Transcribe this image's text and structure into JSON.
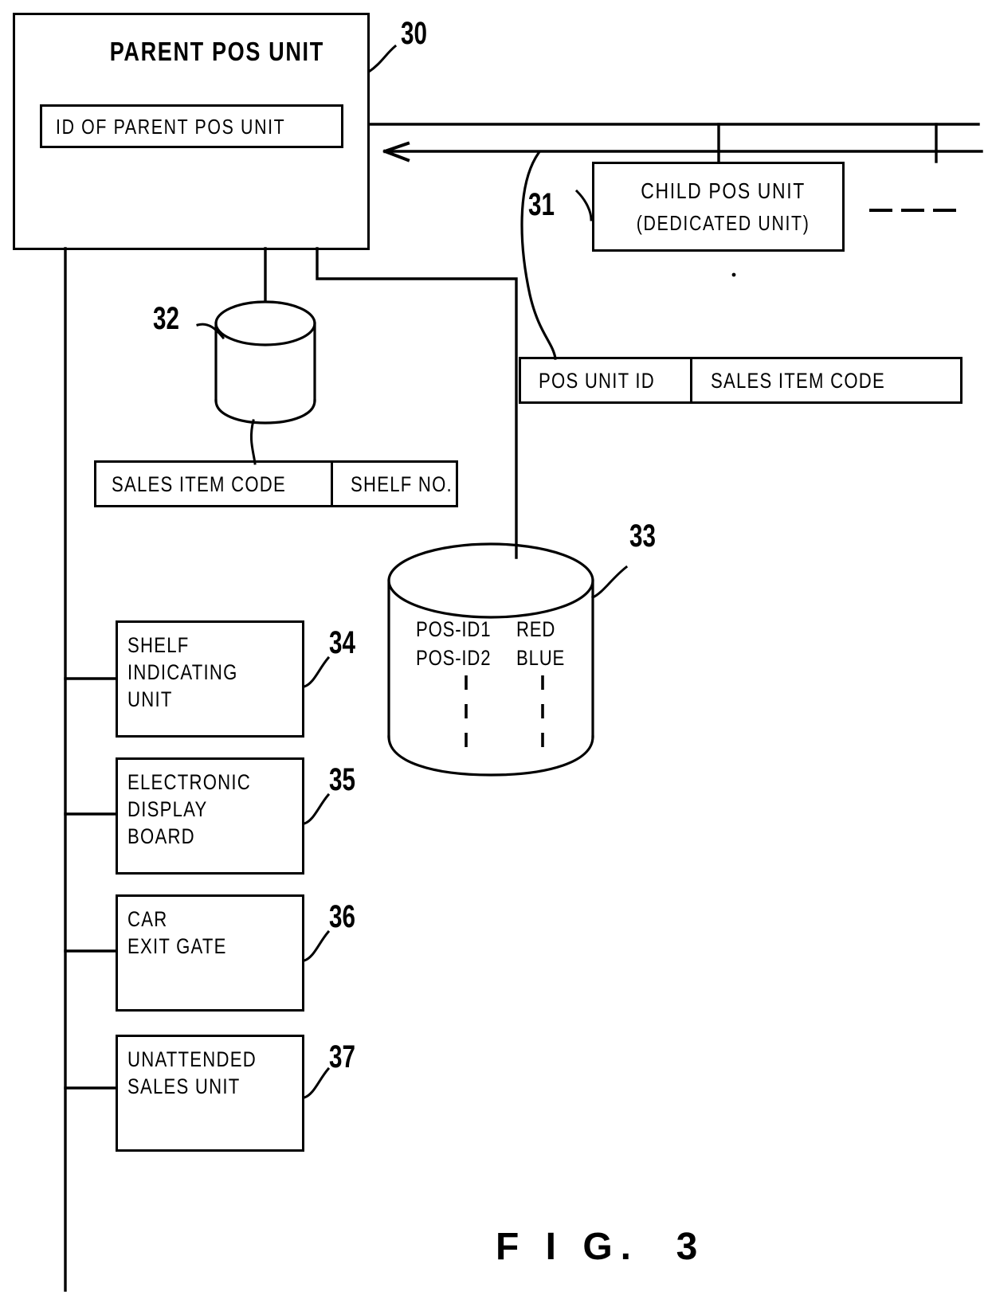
{
  "figure": {
    "caption": "F I G.  3",
    "background": "#ffffff",
    "ink": "#000000"
  },
  "blocks": {
    "parent_pos": {
      "title": "PARENT POS UNIT",
      "ref": "30",
      "inner_field": "ID OF PARENT POS UNIT"
    },
    "child_pos": {
      "title": "CHILD POS UNIT",
      "subtitle": "(DEDICATED UNIT)",
      "ref": "31"
    },
    "shelf_indicating_unit": {
      "label": "SHELF\nINDICATING\nUNIT",
      "ref": "34"
    },
    "electronic_display_board": {
      "label": "ELECTRONIC\nDISPLAY\nBOARD",
      "ref": "35"
    },
    "car_exit_gate": {
      "label": "CAR\nEXIT GATE",
      "ref": "36"
    },
    "unattended_sales_unit": {
      "label": "UNATTENDED\nSALES UNIT",
      "ref": "37"
    }
  },
  "tables": {
    "item_shelf_table": {
      "columns": [
        "SALES ITEM CODE",
        "SHELF NO."
      ]
    },
    "pos_sales_table": {
      "columns": [
        "POS UNIT ID",
        "SALES ITEM CODE"
      ]
    }
  },
  "databases": {
    "item_shelf_db": {
      "ref": "32",
      "contents": []
    },
    "pos_color_db": {
      "ref": "33",
      "rows": [
        {
          "id": "POS-ID1",
          "color": "RED"
        },
        {
          "id": "POS-ID2",
          "color": "BLUE"
        }
      ],
      "continuation": "vertical-dotted-ellipsis"
    }
  },
  "connections": {
    "bus_note": "network bus from parent POS unit to child POS units",
    "dashed_continuation": "- - -",
    "arrow_direction": "left"
  }
}
